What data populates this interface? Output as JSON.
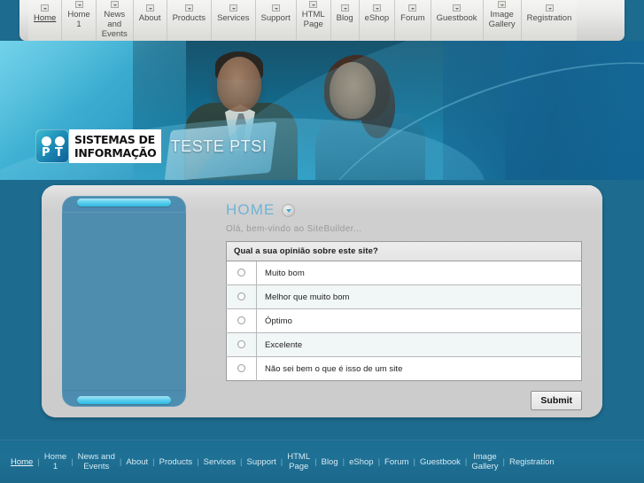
{
  "site": {
    "title": "TESTE PTSI",
    "logo": {
      "letter_1": "P",
      "letter_2": "T",
      "line_1": "SISTEMAS DE",
      "line_2": "INFORMAÇÃO"
    }
  },
  "nav": {
    "items": [
      {
        "label": "Home",
        "active": true
      },
      {
        "label": "Home\n1",
        "active": false
      },
      {
        "label": "News\nand\nEvents",
        "active": false
      },
      {
        "label": "About",
        "active": false
      },
      {
        "label": "Products",
        "active": false
      },
      {
        "label": "Services",
        "active": false
      },
      {
        "label": "Support",
        "active": false
      },
      {
        "label": "HTML\nPage",
        "active": false
      },
      {
        "label": "Blog",
        "active": false
      },
      {
        "label": "eShop",
        "active": false
      },
      {
        "label": "Forum",
        "active": false
      },
      {
        "label": "Guestbook",
        "active": false
      },
      {
        "label": "Image\nGallery",
        "active": false
      },
      {
        "label": "Registration",
        "active": false
      }
    ]
  },
  "main": {
    "page_title": "HOME",
    "welcome_text": "Olá, bem-vindo ao SiteBuilder...",
    "poll": {
      "question": "Qual a sua opinião sobre este site?",
      "options": [
        "Muito bom",
        "Melhor que muito bom",
        "Óptimo",
        "Excelente",
        "Não sei bem o que é isso de um site"
      ],
      "submit_label": "Submit"
    }
  },
  "footer": {
    "separator": "|",
    "items": [
      {
        "label": "Home",
        "active": true
      },
      {
        "label": "Home\n1",
        "active": false
      },
      {
        "label": "News and\nEvents",
        "active": false
      },
      {
        "label": "About",
        "active": false
      },
      {
        "label": "Products",
        "active": false
      },
      {
        "label": "Services",
        "active": false
      },
      {
        "label": "Support",
        "active": false
      },
      {
        "label": "HTML\nPage",
        "active": false
      },
      {
        "label": "Blog",
        "active": false
      },
      {
        "label": "eShop",
        "active": false
      },
      {
        "label": "Forum",
        "active": false
      },
      {
        "label": "Guestbook",
        "active": false
      },
      {
        "label": "Image\nGallery",
        "active": false
      },
      {
        "label": "Registration",
        "active": false
      }
    ]
  },
  "icons": {
    "nav_dropdown": "chevron-down-icon",
    "heading_toggle": "chevron-down-circle-icon",
    "radio": "radio-button-icon"
  },
  "colors": {
    "page_background": "#1d6b8f",
    "banner_cyan": "#35a9cc",
    "panel_gray": "#cfcfcf",
    "sidebox_blue": "#4d8db0",
    "accent_bar": "#5fd0ee",
    "heading_blue": "#6fb3d6",
    "footer_blue": "#1d6e93"
  }
}
